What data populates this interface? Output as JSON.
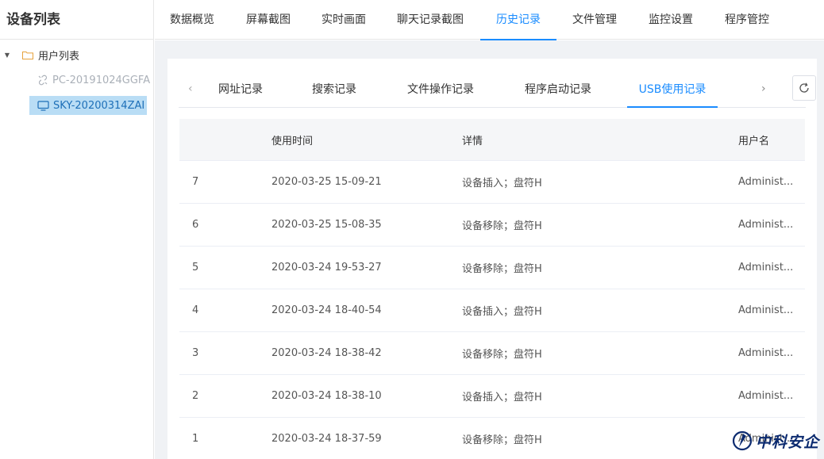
{
  "sidebar": {
    "title": "设备列表",
    "root_label": "用户列表",
    "devices": [
      {
        "name": "PC-20191024GGFA",
        "status": "offline"
      },
      {
        "name": "SKY-20200314ZAI",
        "status": "online-selected"
      }
    ]
  },
  "topnav": {
    "tabs": [
      "数据概览",
      "屏幕截图",
      "实时画面",
      "聊天记录截图",
      "历史记录",
      "文件管理",
      "监控设置",
      "程序管控"
    ],
    "active_index": 4
  },
  "subtabs": {
    "items": [
      "网址记录",
      "搜索记录",
      "文件操作记录",
      "程序启动记录",
      "USB使用记录"
    ],
    "active_index": 4,
    "prev_icon": "chevron-left-icon",
    "next_icon": "chevron-right-icon",
    "refresh_icon": "refresh-icon"
  },
  "table": {
    "columns": [
      "",
      "使用时间",
      "详情",
      "用户名"
    ],
    "rows": [
      {
        "id": "7",
        "time": "2020-03-25 15-09-21",
        "detail": "设备插入；盘符H",
        "user": "Administ..."
      },
      {
        "id": "6",
        "time": "2020-03-25 15-08-35",
        "detail": "设备移除；盘符H",
        "user": "Administ..."
      },
      {
        "id": "5",
        "time": "2020-03-24 19-53-27",
        "detail": "设备移除；盘符H",
        "user": "Administ..."
      },
      {
        "id": "4",
        "time": "2020-03-24 18-40-54",
        "detail": "设备插入；盘符H",
        "user": "Administ..."
      },
      {
        "id": "3",
        "time": "2020-03-24 18-38-42",
        "detail": "设备移除；盘符H",
        "user": "Administ..."
      },
      {
        "id": "2",
        "time": "2020-03-24 18-38-10",
        "detail": "设备插入；盘符H",
        "user": "Administ..."
      },
      {
        "id": "1",
        "time": "2020-03-24 18-37-59",
        "detail": "设备移除；盘符H",
        "user": "Administ..."
      }
    ]
  },
  "watermark": {
    "text": "中科安企"
  },
  "colors": {
    "accent": "#1a8cff",
    "selected_bg": "#b9ddf5",
    "folder": "#e6a23c",
    "panel_bg": "#f0f2f5"
  }
}
